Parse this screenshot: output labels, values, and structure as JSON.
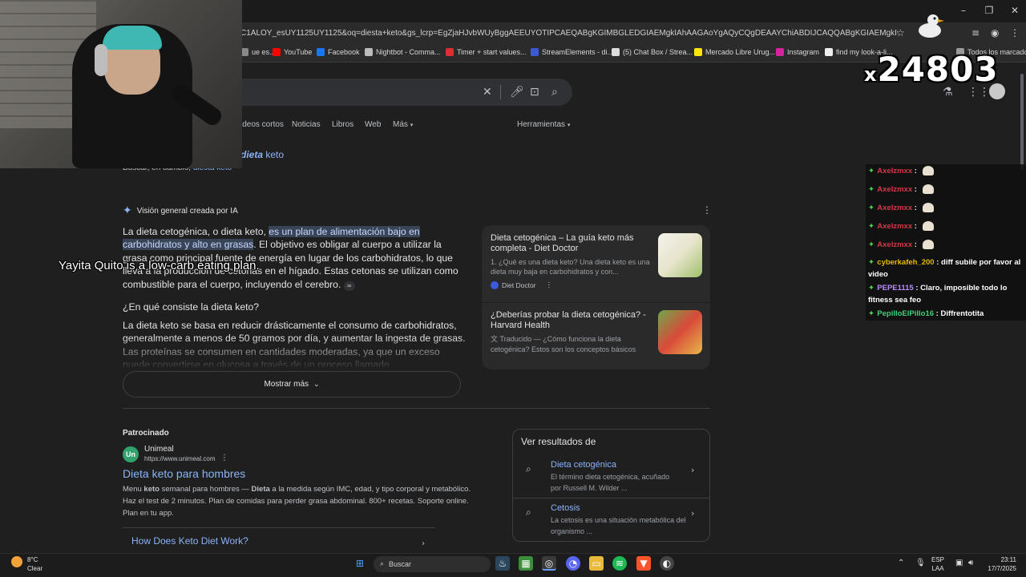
{
  "browser": {
    "url": "C1ALOY_esUY1125UY1125&oq=diesta+keto&gs_lcrp=EgZjaHJvbWUyBggAEEUYOTIPCAEQABgKGIMBGLEDGIAEMgkIAhAAGAoYgAQyCQgDEAAYChiABDIJCAQQABgKGIAEMgkIBRAAGAoYgAQyCQ...",
    "bookmarks": [
      {
        "label": "ue es...",
        "color": "#888888"
      },
      {
        "label": "YouTube",
        "color": "#ff0000"
      },
      {
        "label": "Facebook",
        "color": "#1877f2"
      },
      {
        "label": "Nightbot - Comma...",
        "color": "#bbbbbb"
      },
      {
        "label": "Timer + start values...",
        "color": "#d93030"
      },
      {
        "label": "StreamElements - di...",
        "color": "#3b5bd6"
      },
      {
        "label": "(5) Chat Box / Strea...",
        "color": "#dddddd"
      },
      {
        "label": "Mercado Libre Urug...",
        "color": "#ffe600"
      },
      {
        "label": "Instagram",
        "color": "#d6249f"
      },
      {
        "label": "find my look-a-li...",
        "color": "#eeeeee"
      },
      {
        "label": "Todos los marcadores",
        "color": "#999999"
      }
    ]
  },
  "overlay": {
    "counter_prefix": "x",
    "counter_value": "24803",
    "caption": "Yayita Quito is a low-carb eating plan."
  },
  "google": {
    "tabs": [
      "ideos cortos",
      "Noticias",
      "Libros",
      "Web",
      "Más"
    ],
    "tools": "Herramientas",
    "spell_prefix": "",
    "spell_term": "dieta",
    "spell_rest": " keto",
    "spell2_text": "Buscar, en cambio,",
    "spell2_link": "diesta keto",
    "ai_header": "Visión general creada por IA",
    "ai_p1_a": "La dieta cetogénica, o dieta keto, ",
    "ai_p1_hl": "es un plan de alimentación bajo en carbohidratos y alto en grasas",
    "ai_p1_b": ". El objetivo es obligar al cuerpo a utilizar la grasa como principal fuente de energía en lugar de los carbohidratos, lo que lleva a la producción de cetonas en el hígado. Estas cetonas se utilizan como combustible para el cuerpo, incluyendo el cerebro.",
    "ai_question": "¿En qué consiste la dieta keto?",
    "ai_p2": "La dieta keto se basa en reducir drásticamente el consumo de carbohidratos, generalmente a menos de 50 gramos por día, y aumentar la ingesta de grasas. Las proteínas se consumen en cantidades moderadas, ya que un exceso puede convertirse en glucosa a través de un proceso llamado",
    "show_more": "Mostrar más",
    "cards": [
      {
        "title": "Dieta cetogénica – La guía keto más completa - Diet Doctor",
        "snippet": "1. ¿Qué es una dieta keto? Una dieta keto es una dieta muy baja en carbohidratos y con...",
        "source": "Diet Doctor"
      },
      {
        "title": "¿Deberías probar la dieta cetogénica? - Harvard Health",
        "snippet": "Traducido — ¿Cómo funciona la dieta cetogénica? Estos son los conceptos básicos",
        "source": ""
      }
    ],
    "sponsored": "Patrocinado",
    "ad": {
      "name": "Unimeal",
      "url": "https://www.unimeal.com",
      "logo": "Un",
      "title": "Dieta keto para hombres",
      "desc_a": "Menu ",
      "desc_b1": "keto",
      "desc_c": " semanal para hombres — ",
      "desc_b2": "Dieta",
      "desc_d": " a la medida según IMC, edad, y tipo corporal y metabólico. Haz el test de 2 minutos. Plan de comidas para perder grasa abdominal. 800+ recetas. Soporte online. Plan en tu app.",
      "link": "How Does Keto Diet Work?"
    },
    "see_results": {
      "title": "Ver resultados de",
      "items": [
        {
          "title": "Dieta cetogénica",
          "desc": "El término dieta cetogénica, acuñado por Russell M. Wilder ..."
        },
        {
          "title": "Cetosis",
          "desc": "La cetosis  es una situación metabólica del organismo ..."
        }
      ]
    }
  },
  "chat": [
    {
      "user": "Axelzmxx",
      "color": "#d9364a",
      "msg": "",
      "emote": true
    },
    {
      "user": "Axelzmxx",
      "color": "#d9364a",
      "msg": "",
      "emote": true
    },
    {
      "user": "Axelzmxx",
      "color": "#d9364a",
      "msg": "",
      "emote": true
    },
    {
      "user": "Axelzmxx",
      "color": "#d9364a",
      "msg": "",
      "emote": true
    },
    {
      "user": "Axelzmxx",
      "color": "#d9364a",
      "msg": "",
      "emote": true
    },
    {
      "user": "cyberkafeh_200",
      "color": "#e6b800",
      "msg": "diff subile por favor al video",
      "emote": false
    },
    {
      "user": "PEPE1115",
      "color": "#b78cff",
      "msg": "Claro, imposible todo lo fitness sea feo",
      "emote": false
    },
    {
      "user": "PepilloElPillo16",
      "color": "#3fd17a",
      "msg": "Diffrentotita",
      "emote": false
    }
  ],
  "taskbar": {
    "weather_temp": "8°C",
    "weather_desc": "Clear",
    "search_placeholder": "Buscar",
    "lang1": "ESP",
    "lang2": "LAA",
    "time": "23:11",
    "date": "17/7/2025"
  }
}
